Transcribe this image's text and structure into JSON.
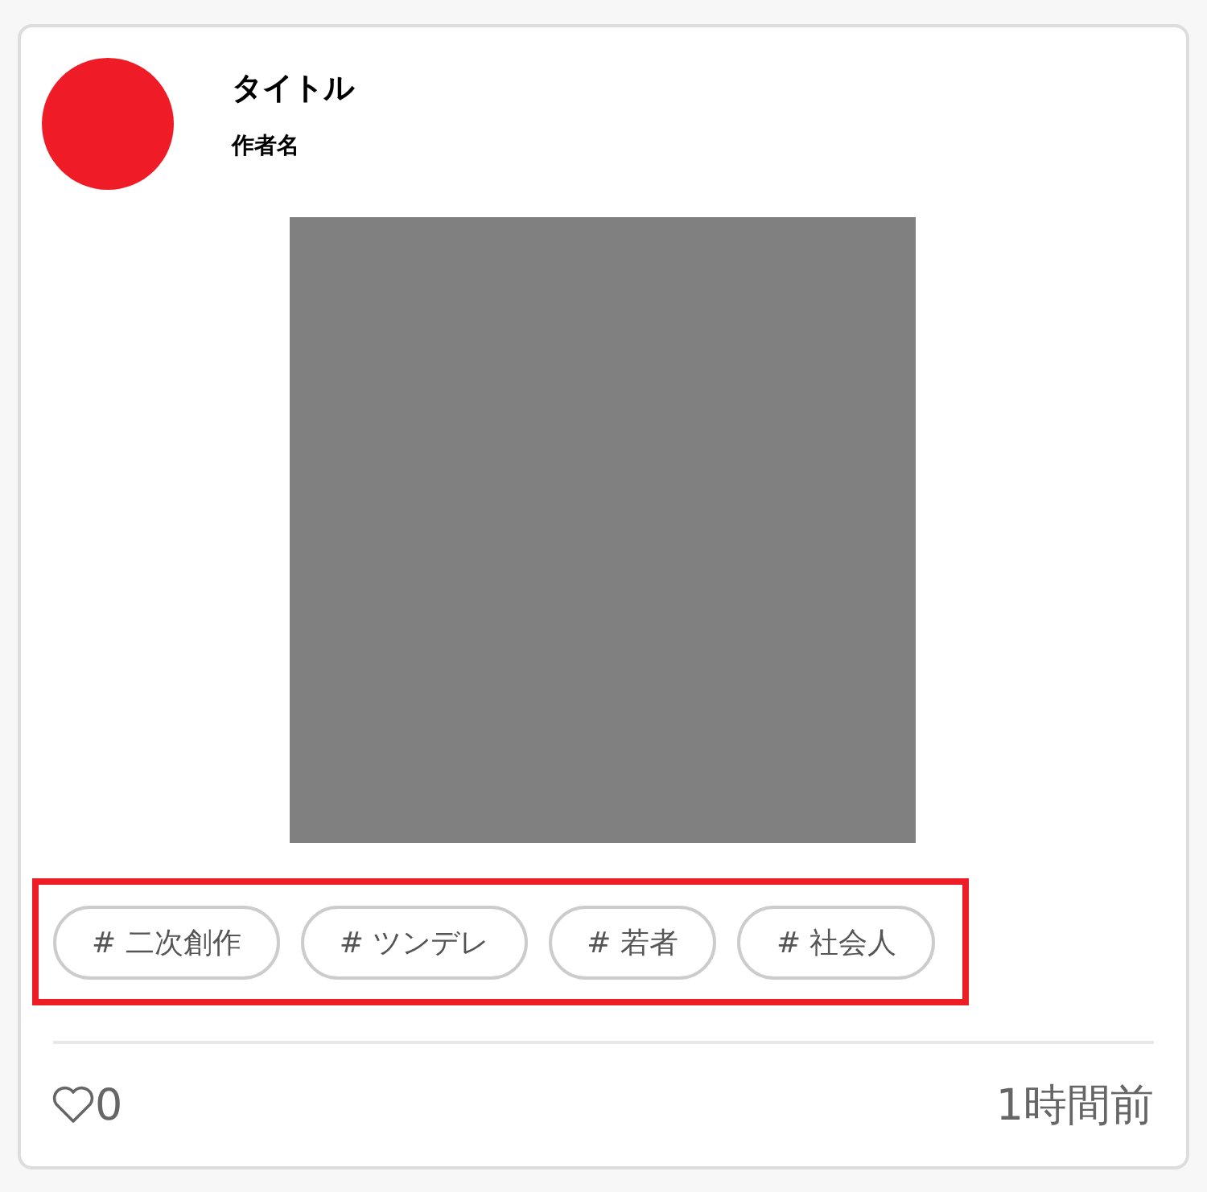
{
  "post": {
    "title": "タイトル",
    "author": "作者名",
    "tags": [
      "# 二次創作",
      "# ツンデレ",
      "# 若者",
      "# 社会人"
    ],
    "likes": "0",
    "time": "1時間前"
  }
}
